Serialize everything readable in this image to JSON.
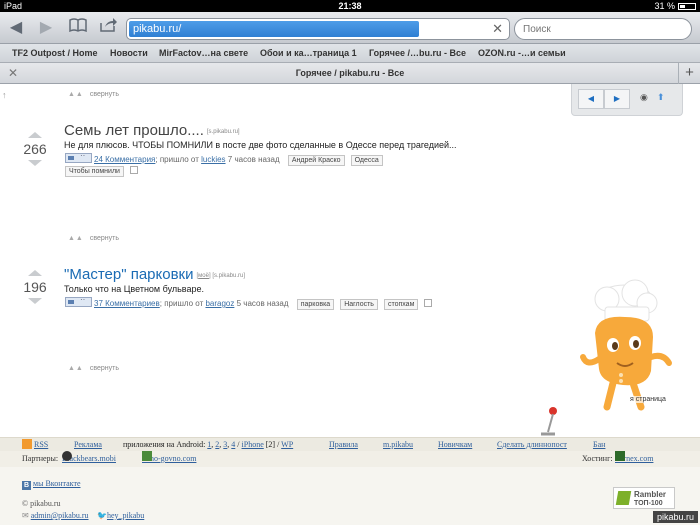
{
  "status_bar": {
    "device": "iPad",
    "time": "21:38",
    "battery": "31 %"
  },
  "toolbar": {
    "url": "pikabu.ru/",
    "search_placeholder": "Поиск"
  },
  "bookmarks": [
    "TF2 Outpost / Home",
    "Новости",
    "MirFactov…на свете",
    "Обои и ка…траница 1",
    "Горячее /…bu.ru - Все",
    "OZON.ru -…и семьи"
  ],
  "tab": {
    "title": "Горячее / pikabu.ru - Все"
  },
  "collapse_label": "свернуть",
  "posts": [
    {
      "votes": "266",
      "title": "Семь лет прошло....",
      "source": "[s.pikabu.ru]",
      "description": "Не для плюсов. ЧТОБЫ ПОМНИЛИ в посте две фото сделанные в Одессе перед трагедией...",
      "comments": "24 Комментария",
      "posted_from": "; пришло от",
      "author": "luckies",
      "time_ago": "7 часов назад",
      "tags": [
        "Андрей Краско",
        "Одесса"
      ],
      "extra_tag": "Чтобы помнили"
    },
    {
      "votes": "196",
      "title": "\"Мастер\" парковки",
      "source_prefix": "[",
      "source_mine": "моё",
      "source_suffix": "] [s.pikabu.ru]",
      "description": "Только что на Цветном бульваре.",
      "comments": "37 Комментариев",
      "posted_from": "; пришло от",
      "author": "baragoz",
      "time_ago": "5 часов назад",
      "tags": [
        "парковка",
        "Наглость",
        "стопхам"
      ]
    }
  ],
  "next_page": "я страница",
  "footer": {
    "rss": "RSS",
    "ads": "Реклама",
    "apps_label": "приложения на Android:",
    "app_links": [
      "1",
      "2",
      "3",
      "4"
    ],
    "iphone": "iPhone",
    "iphone_num": "[2]",
    "wp": "WP",
    "rules": "Правила",
    "mobile": "m.pikabu",
    "newbies": "Новичкам",
    "longpost": "Сделать длиннопост",
    "ban": "Бан",
    "partners_label": "Партнеры:",
    "partner1": "Blackbears.mobi",
    "partner2": "Kino-govno.com",
    "hosting_label": "Хостинг:",
    "hosting": "Fornex.com",
    "vk": "мы Вконтакте",
    "copyright": "© pikabu.ru",
    "email": "admin@pikabu.ru",
    "twitter": "hey_pikabu",
    "rambler_line1": "Rambler",
    "rambler_line2": "ТОП-100",
    "watermark": "pikabu.ru"
  }
}
